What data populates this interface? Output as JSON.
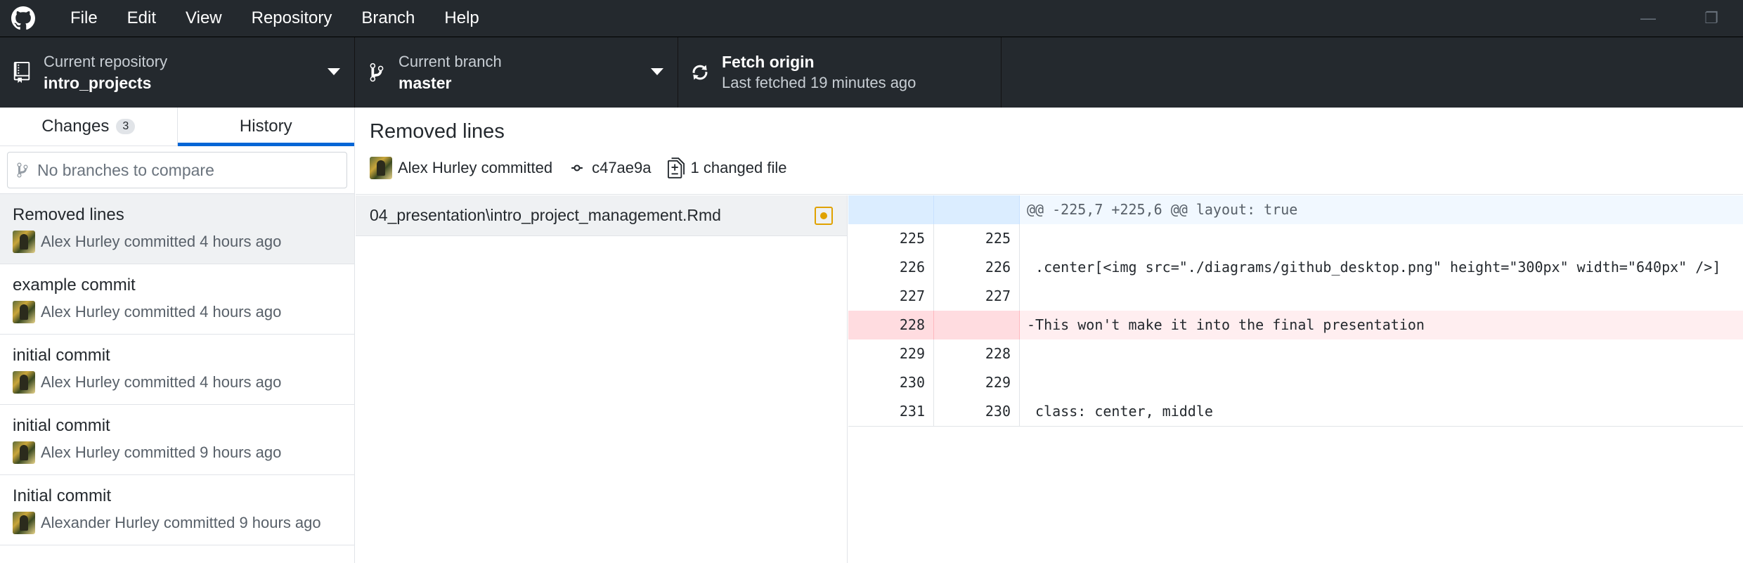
{
  "menu": [
    "File",
    "Edit",
    "View",
    "Repository",
    "Branch",
    "Help"
  ],
  "toolbar": {
    "repo_label": "Current repository",
    "repo_name": "intro_projects",
    "branch_label": "Current branch",
    "branch_name": "master",
    "fetch_title": "Fetch origin",
    "fetch_sub": "Last fetched 19 minutes ago"
  },
  "tabs": {
    "changes": "Changes",
    "changes_count": "3",
    "history": "History"
  },
  "compare": {
    "placeholder": "No branches to compare"
  },
  "commits": [
    {
      "title": "Removed lines",
      "meta": "Alex Hurley committed 4 hours ago"
    },
    {
      "title": "example commit",
      "meta": "Alex Hurley committed 4 hours ago"
    },
    {
      "title": "initial commit",
      "meta": "Alex Hurley committed 4 hours ago"
    },
    {
      "title": "initial commit",
      "meta": "Alex Hurley committed 9 hours ago"
    },
    {
      "title": "Initial commit",
      "meta": "Alexander Hurley committed 9 hours ago"
    }
  ],
  "detail": {
    "title": "Removed lines",
    "author": "Alex Hurley committed",
    "sha": "c47ae9a",
    "changed_files": "1 changed file",
    "file": "04_presentation\\intro_project_management.Rmd"
  },
  "diff": [
    {
      "type": "hunk",
      "old": "",
      "new": "",
      "code": "@@ -225,7 +225,6 @@ layout: true"
    },
    {
      "type": "ctx",
      "old": "225",
      "new": "225",
      "code": ""
    },
    {
      "type": "ctx",
      "old": "226",
      "new": "226",
      "code": " .center[<img src=\"./diagrams/github_desktop.png\" height=\"300px\" width=\"640px\" />]"
    },
    {
      "type": "ctx",
      "old": "227",
      "new": "227",
      "code": ""
    },
    {
      "type": "del",
      "old": "228",
      "new": "",
      "code": "-This won't make it into the final presentation"
    },
    {
      "type": "ctx",
      "old": "229",
      "new": "228",
      "code": ""
    },
    {
      "type": "ctx",
      "old": "230",
      "new": "229",
      "code": ""
    },
    {
      "type": "ctx",
      "old": "231",
      "new": "230",
      "code": " class: center, middle"
    }
  ],
  "colors": {
    "titlebar": "#24292e",
    "accent": "#0366d6",
    "deleted": "#ffeef0",
    "hunk": "#f1f8ff"
  }
}
